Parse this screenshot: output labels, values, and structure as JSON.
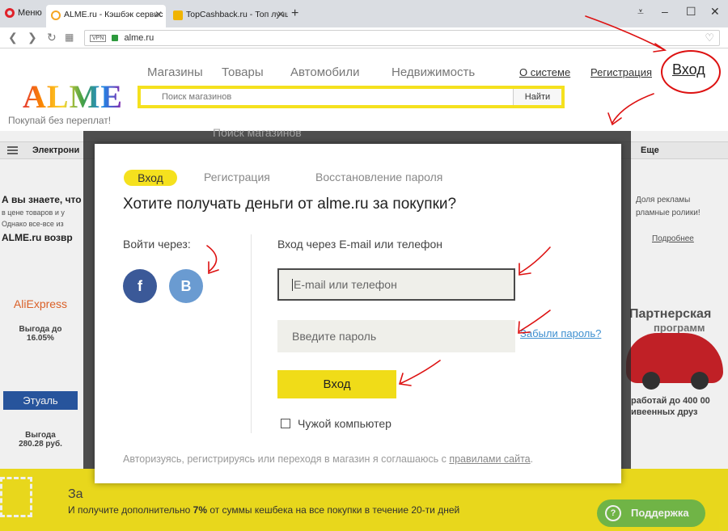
{
  "browser": {
    "menu_label": "Меню",
    "tabs": [
      {
        "label": "ALME.ru - Кэшбэк сервис",
        "favicon_color": "#f5a623"
      },
      {
        "label": "TopCashback.ru - Топ лучших",
        "favicon_color": "#f0b400"
      }
    ],
    "new_tab": "+",
    "url": "alme.ru",
    "vpn_label": "VPN"
  },
  "site": {
    "logo": "ALME",
    "tagline": "Покупай без переплат!",
    "nav": [
      "Магазины",
      "Товары",
      "Автомобили",
      "Недвижимость"
    ],
    "links": [
      "О системе",
      "Регистрация"
    ],
    "login_link": "Вход",
    "search": {
      "placeholder": "Поиск магазинов",
      "button": "Найти"
    }
  },
  "background": {
    "category_strip": "Электрони",
    "more_label": "Еще",
    "ghost_search": "Поиск магазинов",
    "info_title": "А вы знаете, что",
    "info_line1": "в цене товаров и у",
    "info_line2": "Однако все-все из",
    "info_bold": "ALME.ru возвр",
    "ads_text1": "Доля рекламы",
    "ads_text2": "рламные ролики!",
    "ads_more": "Подробнее",
    "shops": [
      {
        "name": "AliExpress",
        "benefit": "Выгода до 16.05%"
      },
      {
        "name": "Этуаль",
        "benefit": "Выгода 280.28 руб."
      }
    ],
    "partner_title": "Партнерская",
    "partner_sub": "программ",
    "partner_line1": "работай до 400 00",
    "partner_line2": "ивеенных друз",
    "promo_title": "За",
    "promo_text_pre": "И получите дополнительно ",
    "promo_percent": "7%",
    "promo_text_post": " от суммы кешбека на все покупки в течение 20-ти дней",
    "support": "Поддержка"
  },
  "modal": {
    "tabs": {
      "login": "Вход",
      "register": "Регистрация",
      "restore": "Восстановление пароля"
    },
    "title": "Хотите получать деньги от alme.ru за покупки?",
    "social_label": "Войти через:",
    "social": [
      {
        "label": "f",
        "name": "facebook",
        "color": "#3b5998"
      },
      {
        "label": "B",
        "name": "vkontakte",
        "color": "#6a9bd1"
      }
    ],
    "email_label": "Вход через E-mail или телефон",
    "email_placeholder": "E-mail или телефон",
    "password_placeholder": "Введите пароль",
    "forgot": "Забыли пароль?",
    "submit": "Вход",
    "foreign_pc": "Чужой компьютер",
    "terms_pre": "Авторизуясь, регистрируясь или переходя в магазин я соглашаюсь с ",
    "terms_link": "правилами сайта",
    "terms_post": "."
  },
  "colors": {
    "brand_yellow": "#f5e11e",
    "button_yellow": "#f0dc18",
    "link_blue": "#3d8fd0",
    "annotation_red": "#dd1111"
  }
}
